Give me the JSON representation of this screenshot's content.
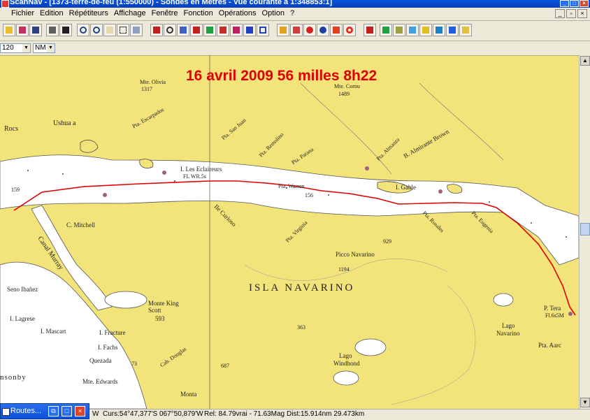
{
  "window": {
    "title": "ScanNav - [1373-terre-de-feu (1:550000) - Sondes en  Mètres  - Vue courante à 1:348853:1]",
    "buttons": [
      "_",
      "□",
      "×"
    ]
  },
  "menu": {
    "items": [
      "Fichier",
      "Edition",
      "Répétiteurs",
      "Affichage",
      "Fenêtre",
      "Fonction",
      "Opérations",
      "Option",
      "?"
    ],
    "mdi_buttons": [
      "_",
      "▫",
      "×"
    ]
  },
  "selectors": {
    "scale_value": "120",
    "unit_value": "NM"
  },
  "map": {
    "annotation": "16 avril 2009 56 milles 8h22",
    "labels": {
      "isla": "ISLA  NAVARINO",
      "picco": "Picco Navarino",
      "lago_nav_1": "Lago",
      "lago_nav_2": "Navarino",
      "lago_win_1": "Lago",
      "lago_win_2": "Windhond",
      "c_mitchell": "C. Mitchell",
      "ushuaia": "Ushua a",
      "rocs": "Rocs",
      "mte_olivia": "Mte. Olivia",
      "mte_olivia_h": "1317",
      "mte_cornu": "Mte. Cornu",
      "mte_cornu_h": "1489",
      "i_les_eclaireurs": "I. Les Eclaireurs",
      "i_gable": "I. Gable",
      "pta_parana": "Pta. Parana",
      "pta_remolino": "Pta. Remolino",
      "pta_san_juan": "Pta. San Juan",
      "pta_escarpados": "Pta. Escarpados",
      "b_almirante_brown": "B. Almirante Brown",
      "pta_almanza": "Pta. Almanza",
      "ile_curioso": "Ile Curioso",
      "pta_virginia": "Pta. Virginia",
      "pta_rosales": "Pta. Rosales",
      "pta_eugenia": "Pta. Eugenia",
      "seno_ibanez": "Seno Ibañez",
      "i_lagrese": "I. Lagrese",
      "i_mascart": "I. Mascart",
      "i_fachs": "I. Fachs",
      "quezada": "Quezada",
      "monte_king_scott": "Monte King Scott",
      "mks_h": "593",
      "mte_edwards": "Mte. Edwards",
      "cab_douglas": "Cab. Douglas",
      "p_tera": "P. Tera",
      "pta_aarc": "Pta. Aarc",
      "insonby": "nsonby",
      "canal_murray": "Canal Murray",
      "h_1194": "1194",
      "h_929": "929",
      "h_363": "363",
      "h_687": "687",
      "h_73": "73",
      "h_156": "156",
      "h_159": "159",
      "fl_eclaireurs": "FL WR.5s",
      "fl_tera": "Fl.6s5M",
      "wrong_name": "Pta. Warren",
      "i_fracture": "I. Fracture",
      "monta": "Monta"
    }
  },
  "status": {
    "curs": "Curs:54°47,377'S 067°50,879'W",
    "rel": "Rel: 84.79vrai - 71.63Mag",
    "dist": "Dist:15.914nm  29.473km",
    "w": "W"
  },
  "routes_window": {
    "label": "Routes..."
  },
  "colors": {
    "land": "#f2e37a",
    "water": "#ffffff",
    "route": "#e00000",
    "title_bar": "#0a52d9"
  }
}
